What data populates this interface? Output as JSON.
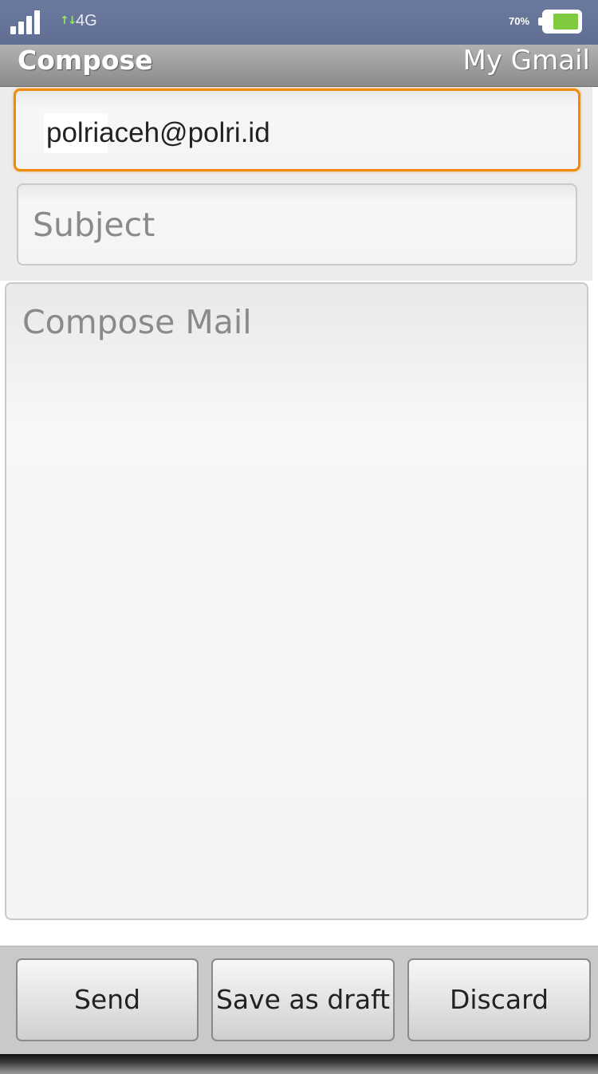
{
  "status_bar": {
    "network_type": "4G",
    "data_arrows": "↑↓",
    "battery_percent_text": "70%",
    "battery_level": 0.7,
    "battery_color": "#7fca3e"
  },
  "title_bar": {
    "title": "Compose",
    "app_name": "My Gmail"
  },
  "compose": {
    "to_value": "polriaceh@polri.id",
    "subject_placeholder": "Subject",
    "body_placeholder": "Compose Mail"
  },
  "buttons": {
    "send": "Send",
    "save_draft": "Save as draft",
    "discard": "Discard"
  },
  "colors": {
    "focus_accent": "#f08a0a"
  }
}
